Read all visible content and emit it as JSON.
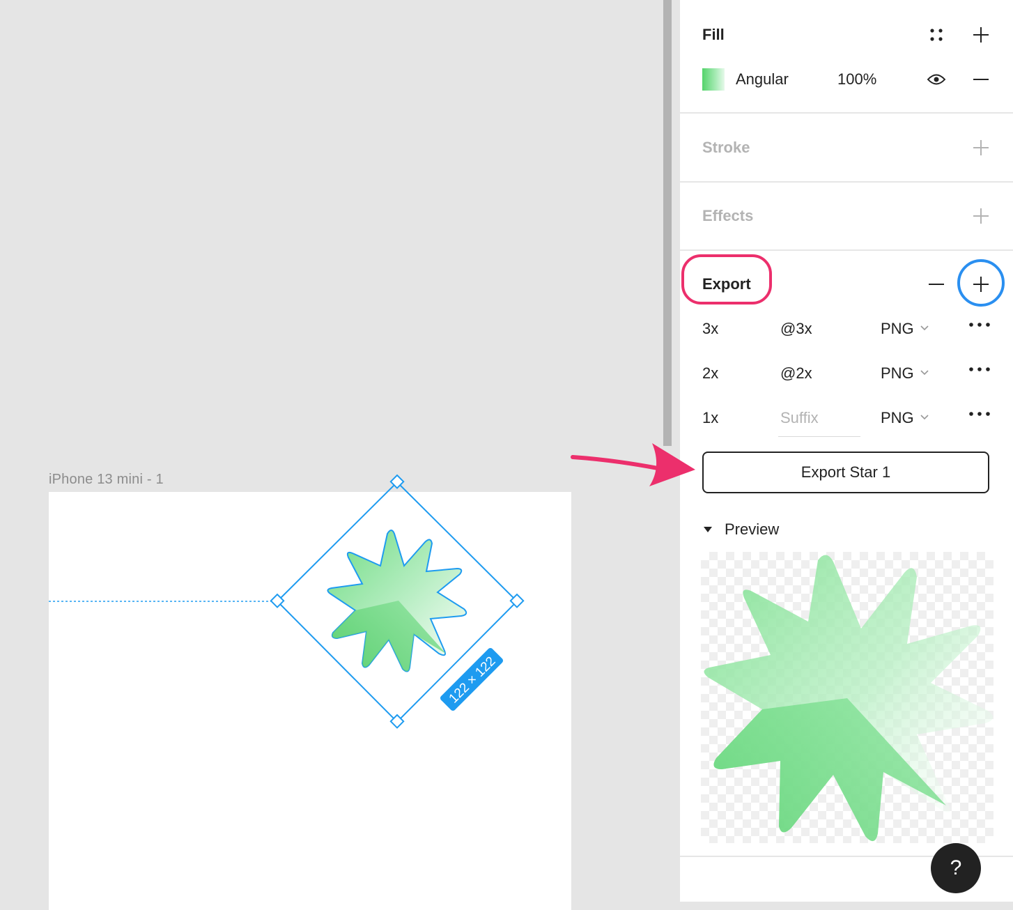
{
  "canvas": {
    "frame_label": "iPhone 13 mini - 1",
    "selection_size_label": "122 × 122"
  },
  "panel": {
    "fill": {
      "title": "Fill",
      "layer": {
        "type": "Angular",
        "opacity": "100%"
      },
      "icons": [
        "style-grid-icon",
        "plus-icon",
        "eye-icon",
        "minus-icon"
      ]
    },
    "stroke": {
      "title": "Stroke"
    },
    "effects": {
      "title": "Effects"
    },
    "export": {
      "title": "Export",
      "rows": [
        {
          "scale": "3x",
          "suffix": "@3x",
          "format": "PNG"
        },
        {
          "scale": "2x",
          "suffix": "@2x",
          "format": "PNG"
        },
        {
          "scale": "1x",
          "suffix_placeholder": "Suffix",
          "format": "PNG"
        }
      ],
      "button_label": "Export Star 1"
    },
    "preview": {
      "label": "Preview"
    }
  },
  "help": {
    "label": "?"
  },
  "colors": {
    "selection_blue": "#1e9bf0",
    "star_green": "#54d36b",
    "highlight_pink": "#ec2f6c",
    "highlight_blue": "#2a8ff0"
  }
}
